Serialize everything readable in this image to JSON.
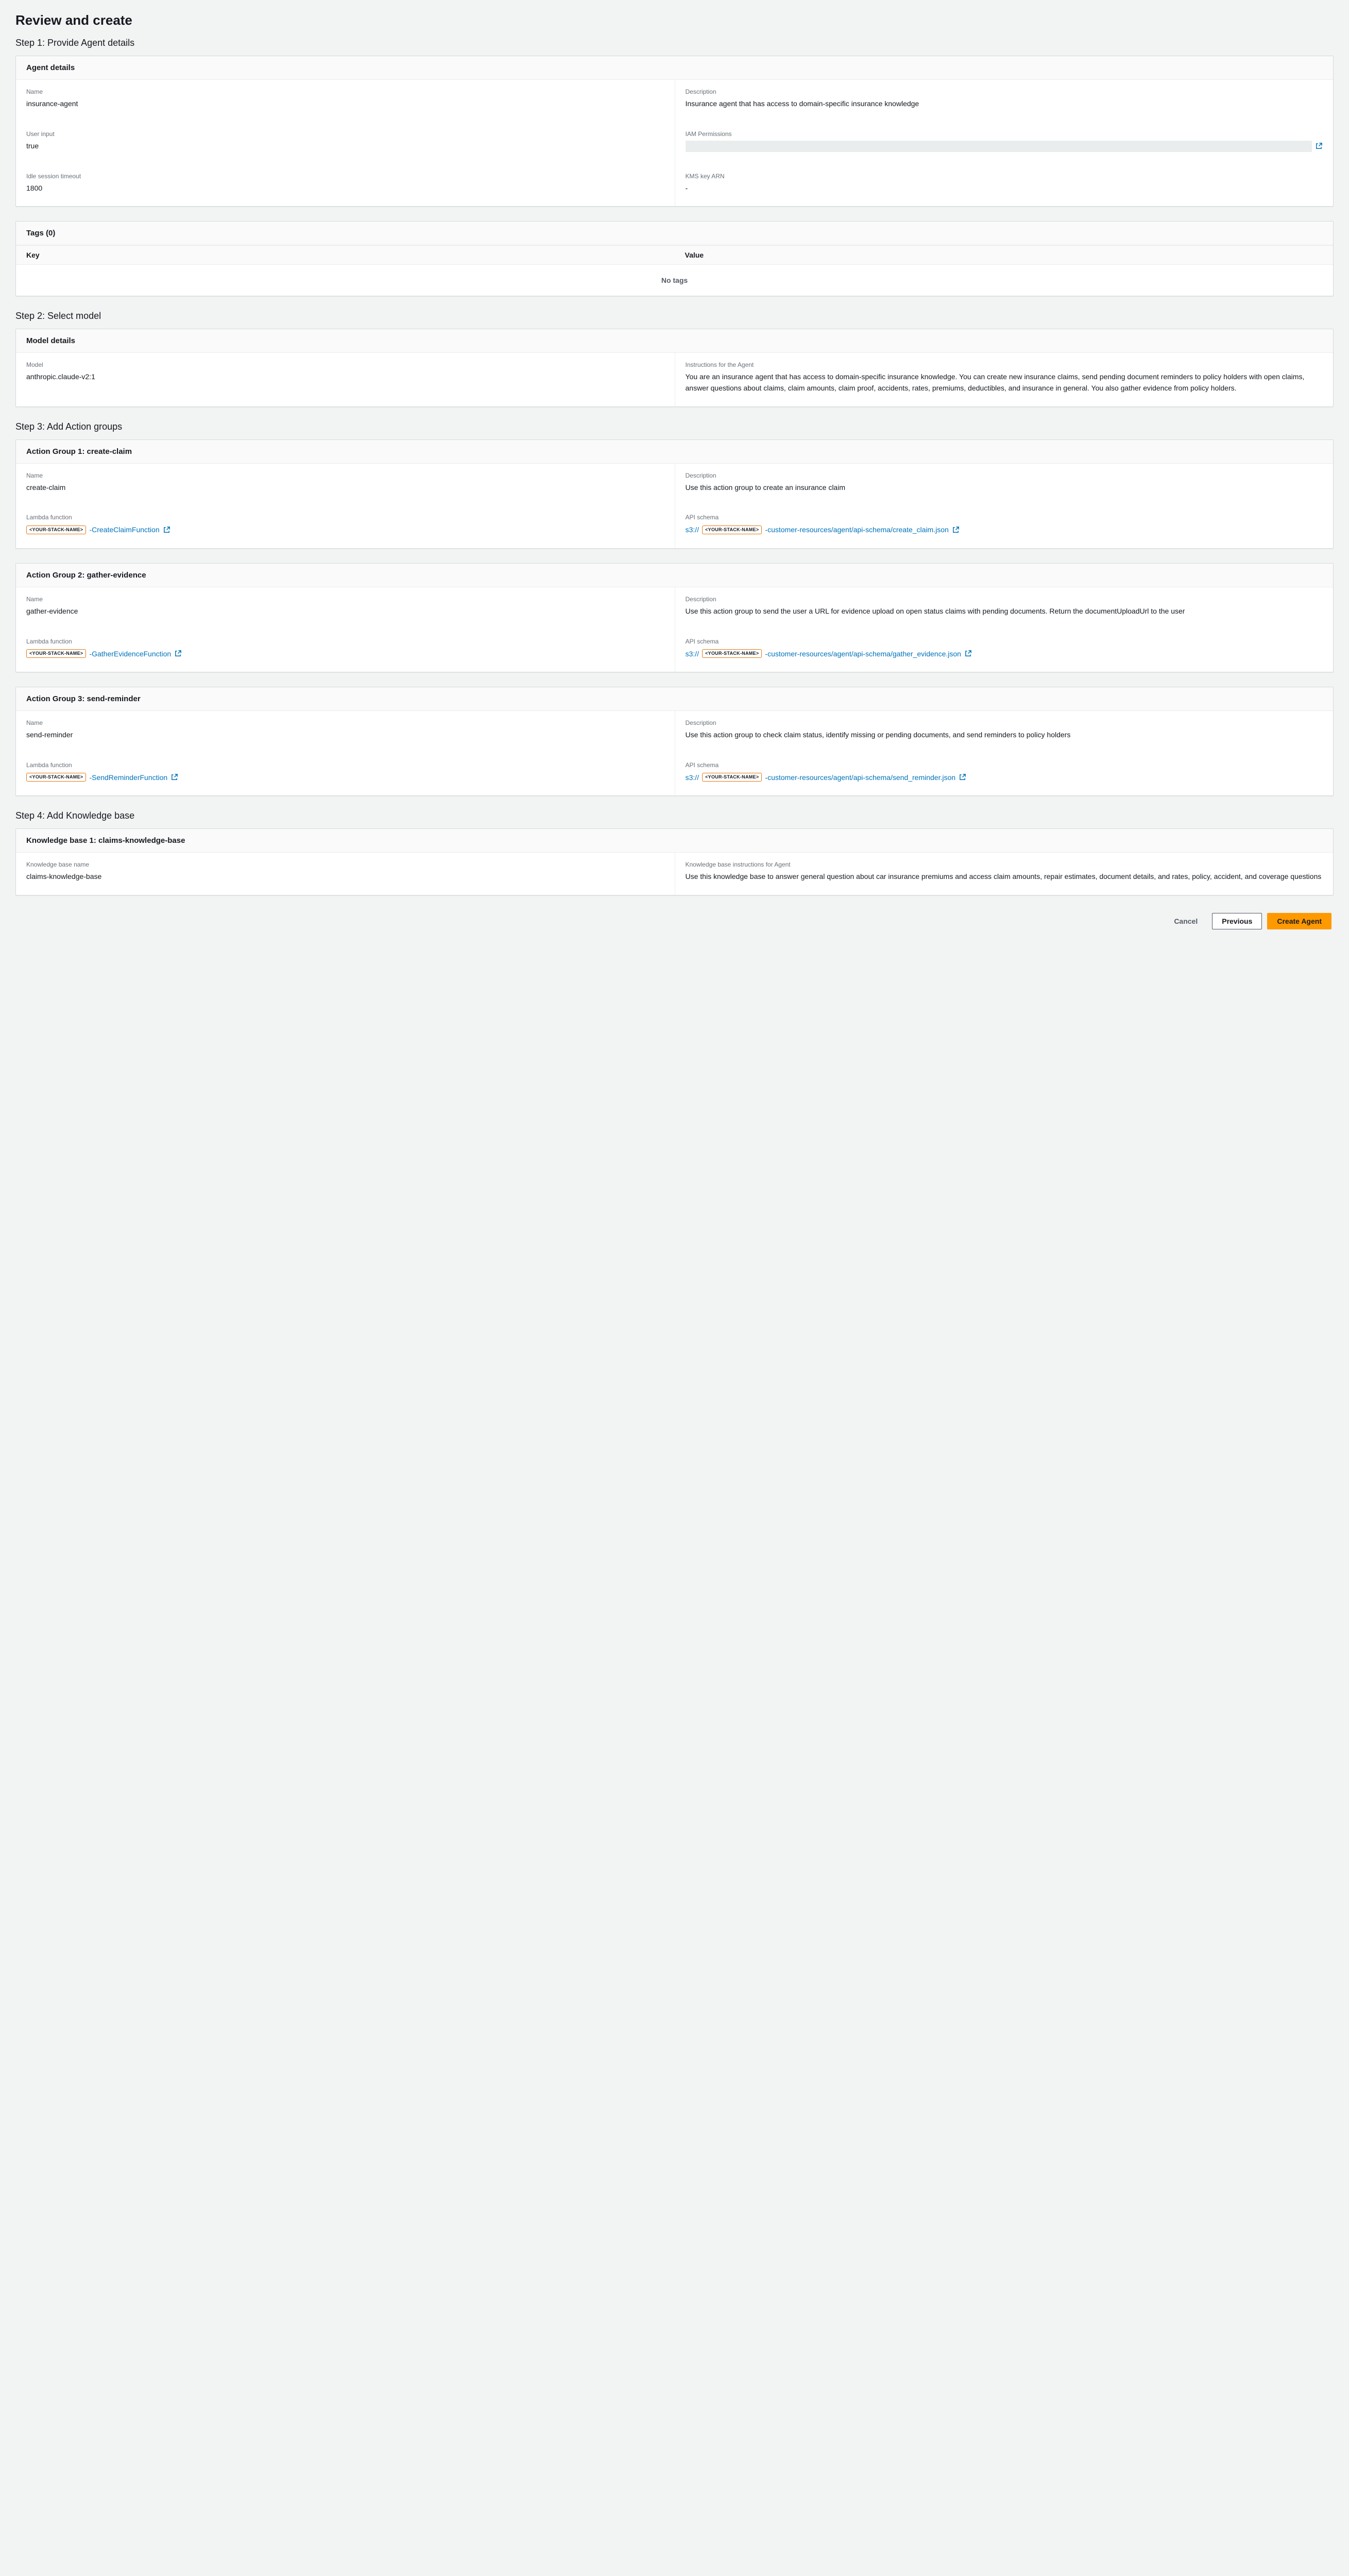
{
  "page_title": "Review and create",
  "stack_name_placeholder": "<YOUR-STACK-NAME>",
  "step1": {
    "title": "Step 1: Provide Agent details",
    "panel_title": "Agent details",
    "name_label": "Name",
    "name_value": "insurance-agent",
    "description_label": "Description",
    "description_value": "Insurance agent that has access to domain-specific insurance knowledge",
    "user_input_label": "User input",
    "user_input_value": "true",
    "iam_label": "IAM Permissions",
    "idle_label": "Idle session timeout",
    "idle_value": "1800",
    "kms_label": "KMS key ARN",
    "kms_value": "-",
    "tags_title": "Tags (0)",
    "tags_key_header": "Key",
    "tags_value_header": "Value",
    "tags_empty": "No tags"
  },
  "step2": {
    "title": "Step 2: Select model",
    "panel_title": "Model details",
    "model_label": "Model",
    "model_value": "anthropic.claude-v2:1",
    "instructions_label": "Instructions for the Agent",
    "instructions_value": "You are an insurance agent that has access to domain-specific insurance knowledge. You can create new insurance claims, send pending document reminders to policy holders with open claims, answer questions about claims, claim amounts, claim proof, accidents, rates, premiums, deductibles, and insurance in general. You also gather evidence from policy holders."
  },
  "step3": {
    "title": "Step 3: Add Action groups",
    "groups": [
      {
        "panel_title": "Action Group 1: create-claim",
        "name_label": "Name",
        "name_value": "create-claim",
        "description_label": "Description",
        "description_value": "Use this action group to create an insurance claim",
        "lambda_label": "Lambda function",
        "lambda_suffix": "-CreateClaimFunction",
        "api_label": "API schema",
        "api_prefix": "s3://",
        "api_suffix": "-customer-resources/agent/api-schema/create_claim.json"
      },
      {
        "panel_title": "Action Group 2: gather-evidence",
        "name_label": "Name",
        "name_value": "gather-evidence",
        "description_label": "Description",
        "description_value": "Use this action group to send the user a URL for evidence upload on open status claims with pending documents. Return the documentUploadUrl to the user",
        "lambda_label": "Lambda function",
        "lambda_suffix": "-GatherEvidenceFunction",
        "api_label": "API schema",
        "api_prefix": "s3://",
        "api_suffix": "-customer-resources/agent/api-schema/gather_evidence.json"
      },
      {
        "panel_title": "Action Group 3: send-reminder",
        "name_label": "Name",
        "name_value": "send-reminder",
        "description_label": "Description",
        "description_value": "Use this action group to check claim status, identify missing or pending documents, and send reminders to policy holders",
        "lambda_label": "Lambda function",
        "lambda_suffix": "-SendReminderFunction",
        "api_label": "API schema",
        "api_prefix": "s3://",
        "api_suffix": "-customer-resources/agent/api-schema/send_reminder.json"
      }
    ]
  },
  "step4": {
    "title": "Step 4: Add Knowledge base",
    "panel_title": "Knowledge base 1: claims-knowledge-base",
    "name_label": "Knowledge base name",
    "name_value": "claims-knowledge-base",
    "instructions_label": "Knowledge base instructions for Agent",
    "instructions_value": "Use this knowledge base to answer general question about car insurance premiums and access claim amounts, repair estimates, document details, and rates, policy, accident, and coverage questions"
  },
  "footer": {
    "cancel": "Cancel",
    "previous": "Previous",
    "create": "Create Agent"
  }
}
